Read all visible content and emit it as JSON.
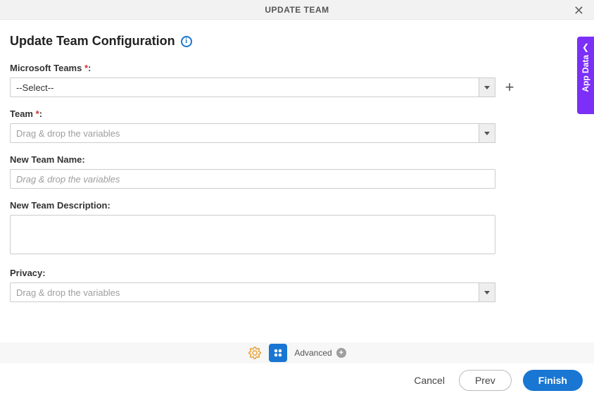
{
  "header": {
    "title": "UPDATE TEAM"
  },
  "page": {
    "heading": "Update Team Configuration"
  },
  "fields": {
    "microsoft_teams": {
      "label": "Microsoft Teams",
      "required_mark": "*",
      "colon": ":",
      "value": "--Select--"
    },
    "team": {
      "label": "Team",
      "required_mark": "*",
      "colon": ":",
      "placeholder": "Drag & drop the variables"
    },
    "new_team_name": {
      "label": "New Team Name:",
      "placeholder": "Drag & drop the variables"
    },
    "new_team_description": {
      "label": "New Team Description:"
    },
    "privacy": {
      "label": "Privacy:",
      "placeholder": "Drag & drop the variables"
    }
  },
  "toolbar": {
    "advanced_label": "Advanced"
  },
  "footer": {
    "cancel": "Cancel",
    "prev": "Prev",
    "finish": "Finish"
  },
  "sidebar": {
    "label": "App Data"
  }
}
